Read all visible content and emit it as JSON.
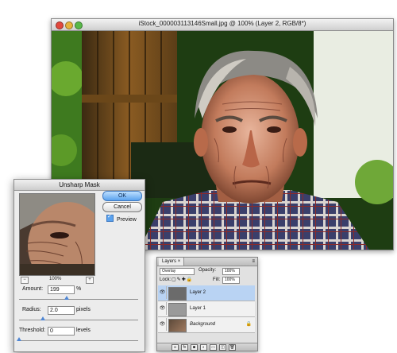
{
  "document": {
    "title": "iStock_000003113146Small.jpg @ 100% (Layer 2, RGB/8*)"
  },
  "unsharp_mask": {
    "title": "Unsharp Mask",
    "ok_label": "OK",
    "cancel_label": "Cancel",
    "preview_label": "Preview",
    "preview_checked": true,
    "zoom_out_label": "−",
    "zoom_in_label": "+",
    "zoom_level": "100%",
    "amount_label": "Amount:",
    "amount_value": "199",
    "amount_unit": "%",
    "amount_fraction": 0.4,
    "radius_label": "Radius:",
    "radius_value": "2.0",
    "radius_unit": "pixels",
    "radius_fraction": 0.2,
    "threshold_label": "Threshold:",
    "threshold_value": "0",
    "threshold_unit": "levels",
    "threshold_fraction": 0.0
  },
  "layers_panel": {
    "tab_label": "Layers",
    "blend_mode": "Overlay",
    "opacity_label": "Opacity:",
    "opacity_value": "100%",
    "lock_label": "Lock:",
    "fill_label": "Fill:",
    "fill_value": "100%",
    "layers": [
      {
        "name": "Layer 2",
        "selected": true,
        "locked": false
      },
      {
        "name": "Layer 1",
        "selected": false,
        "locked": false
      },
      {
        "name": "Background",
        "selected": false,
        "locked": true
      }
    ],
    "bottom_icons": [
      "link-icon",
      "fx-icon",
      "mask-icon",
      "adjustment-icon",
      "folder-icon",
      "new-layer-icon",
      "trash-icon"
    ]
  },
  "colors": {
    "selection_blue": "#b9d3f3",
    "ok_button_blue": "#5aa2ee",
    "slider_thumb": "#4f86d3"
  }
}
